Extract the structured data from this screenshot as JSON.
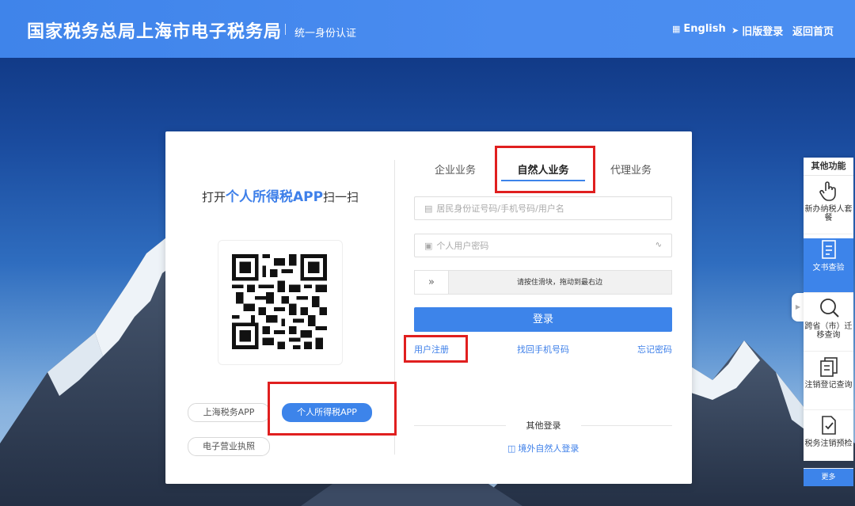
{
  "header": {
    "site_title": "国家税务总局上海市电子税务局",
    "subtitle": "统一身份认证",
    "nav": {
      "english": "English",
      "old_login": "旧版登录",
      "home": "返回首页"
    }
  },
  "left_panel": {
    "scan_prefix": "打开",
    "scan_highlight": "个人所得税APP",
    "scan_suffix": "扫一扫",
    "apps": [
      "上海税务APP",
      "个人所得税APP",
      "电子营业执照"
    ],
    "active_app": "个人所得税APP"
  },
  "tabs": [
    {
      "label": "企业业务",
      "active": false
    },
    {
      "label": "自然人业务",
      "active": true
    },
    {
      "label": "代理业务",
      "active": false
    }
  ],
  "form": {
    "id_placeholder": "居民身份证号码/手机号码/用户名",
    "password_placeholder": "个人用户密码",
    "slider_text": "请按住滑块，拖动到最右边",
    "login_label": "登录",
    "links": {
      "register": "用户注册",
      "recover_phone": "找回手机号码",
      "forgot_password": "忘记密码"
    },
    "other_login_title": "其他登录",
    "foreign_login": "境外自然人登录"
  },
  "sidebar": {
    "title": "其他功能",
    "items": [
      {
        "label": "新办纳税人套餐",
        "icon": "hand-pointer-icon",
        "active": false
      },
      {
        "label": "文书查验",
        "icon": "document-icon",
        "active": true
      },
      {
        "label": "跨省（市）迁移查询",
        "icon": "search-icon",
        "active": false
      },
      {
        "label": "注销登记查询",
        "icon": "copy-document-icon",
        "active": false
      },
      {
        "label": "税务注销预检",
        "icon": "document-check-icon",
        "active": false
      }
    ],
    "more": "更多"
  },
  "colors": {
    "primary": "#3d84ea",
    "highlight_box": "#e01f1f",
    "header": "#4a8cf0"
  }
}
